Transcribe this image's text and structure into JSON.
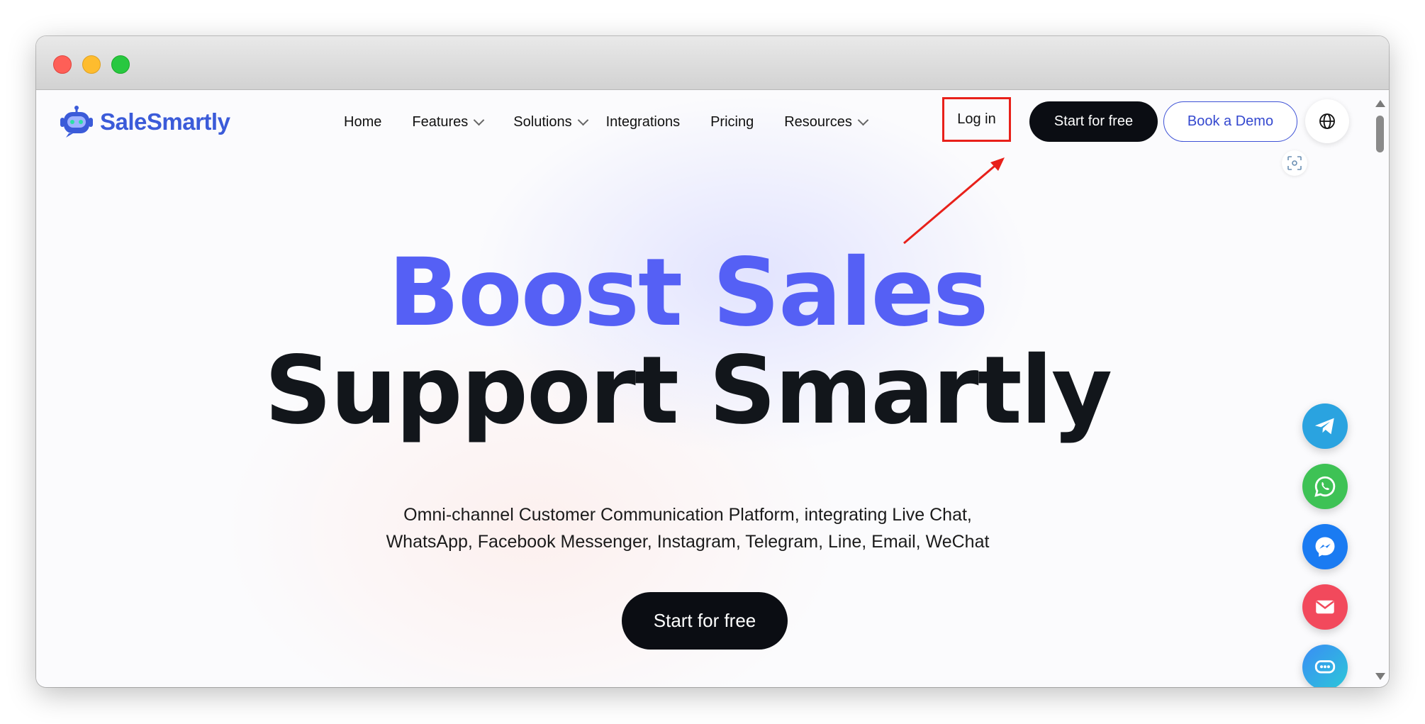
{
  "brand": {
    "name": "SaleSmartly",
    "color": "#3b5bd9"
  },
  "nav": {
    "items": [
      {
        "label": "Home",
        "has_dropdown": false
      },
      {
        "label": "Features",
        "has_dropdown": true
      },
      {
        "label": "Solutions",
        "has_dropdown": true
      },
      {
        "label": "Integrations",
        "has_dropdown": false
      },
      {
        "label": "Pricing",
        "has_dropdown": false
      },
      {
        "label": "Resources",
        "has_dropdown": true
      }
    ],
    "login_label": "Log in",
    "start_label": "Start for free",
    "demo_label": "Book a Demo",
    "globe_icon": "globe-icon"
  },
  "hero": {
    "line1": "Boost Sales",
    "line2": "Support Smartly",
    "subtitle_line1": "Omni-channel Customer Communication Platform, integrating Live Chat,",
    "subtitle_line2": "WhatsApp, Facebook Messenger, Instagram, Telegram, Line, Email, WeChat",
    "cta_label": "Start for free",
    "accent_color": "#5560f5"
  },
  "annotation": {
    "highlight_color": "#e8201a",
    "target": "Log in"
  },
  "floating_contacts": [
    {
      "icon": "telegram-icon",
      "color": "#2aa3e0"
    },
    {
      "icon": "whatsapp-icon",
      "color": "#3ec255"
    },
    {
      "icon": "messenger-icon",
      "color": "#1a7bf2"
    },
    {
      "icon": "email-icon",
      "color": "#f2495c"
    },
    {
      "icon": "chat-icon",
      "color": "#2ca9e6"
    }
  ]
}
